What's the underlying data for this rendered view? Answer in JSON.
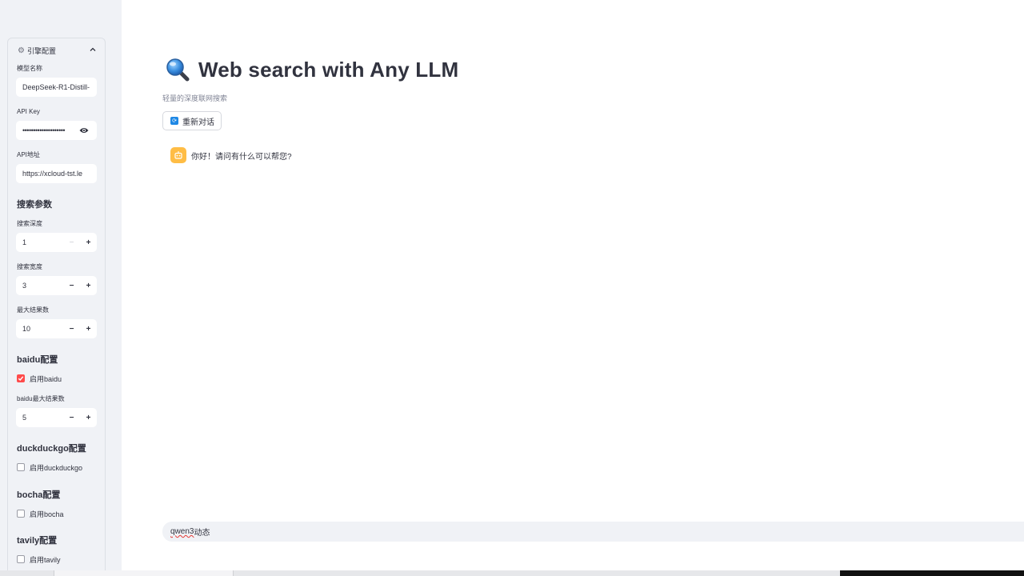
{
  "sidebar": {
    "panel_title": "引擎配置",
    "model_name": {
      "label": "模型名称",
      "value": "DeepSeek-R1-Distill-"
    },
    "api_key": {
      "label": "API Key",
      "value": "••••••••••••••••••••"
    },
    "api_url": {
      "label": "API地址",
      "value": "https://xcloud-tst.le"
    },
    "search_params": {
      "title": "搜索参数",
      "depth": {
        "label": "搜索深度",
        "value": "1"
      },
      "breadth": {
        "label": "搜索宽度",
        "value": "3"
      },
      "max_results": {
        "label": "最大结果数",
        "value": "10"
      }
    },
    "baidu": {
      "title": "baidu配置",
      "enable_label": "启用baidu",
      "enabled": true,
      "max_results": {
        "label": "baidu最大结果数",
        "value": "5"
      }
    },
    "duckduckgo": {
      "title": "duckduckgo配置",
      "enable_label": "启用duckduckgo",
      "enabled": false
    },
    "bocha": {
      "title": "bocha配置",
      "enable_label": "启用bocha",
      "enabled": false
    },
    "tavily": {
      "title": "tavily配置",
      "enable_label": "启用tavily",
      "enabled": false
    },
    "minus": "−",
    "plus": "+"
  },
  "main": {
    "title": "Web search with Any LLM",
    "subtitle": "轻量的深度联网搜索",
    "reset_button": "重新对话",
    "assistant_message": "你好！请问有什么可以帮您?",
    "chat_input_prefix": "qwen3",
    "chat_input_suffix": "动态"
  },
  "colors": {
    "accent": "#ff4b4b",
    "sidebar_bg": "#f0f2f6",
    "avatar_bg": "#ffbd45",
    "text": "#31333f"
  }
}
